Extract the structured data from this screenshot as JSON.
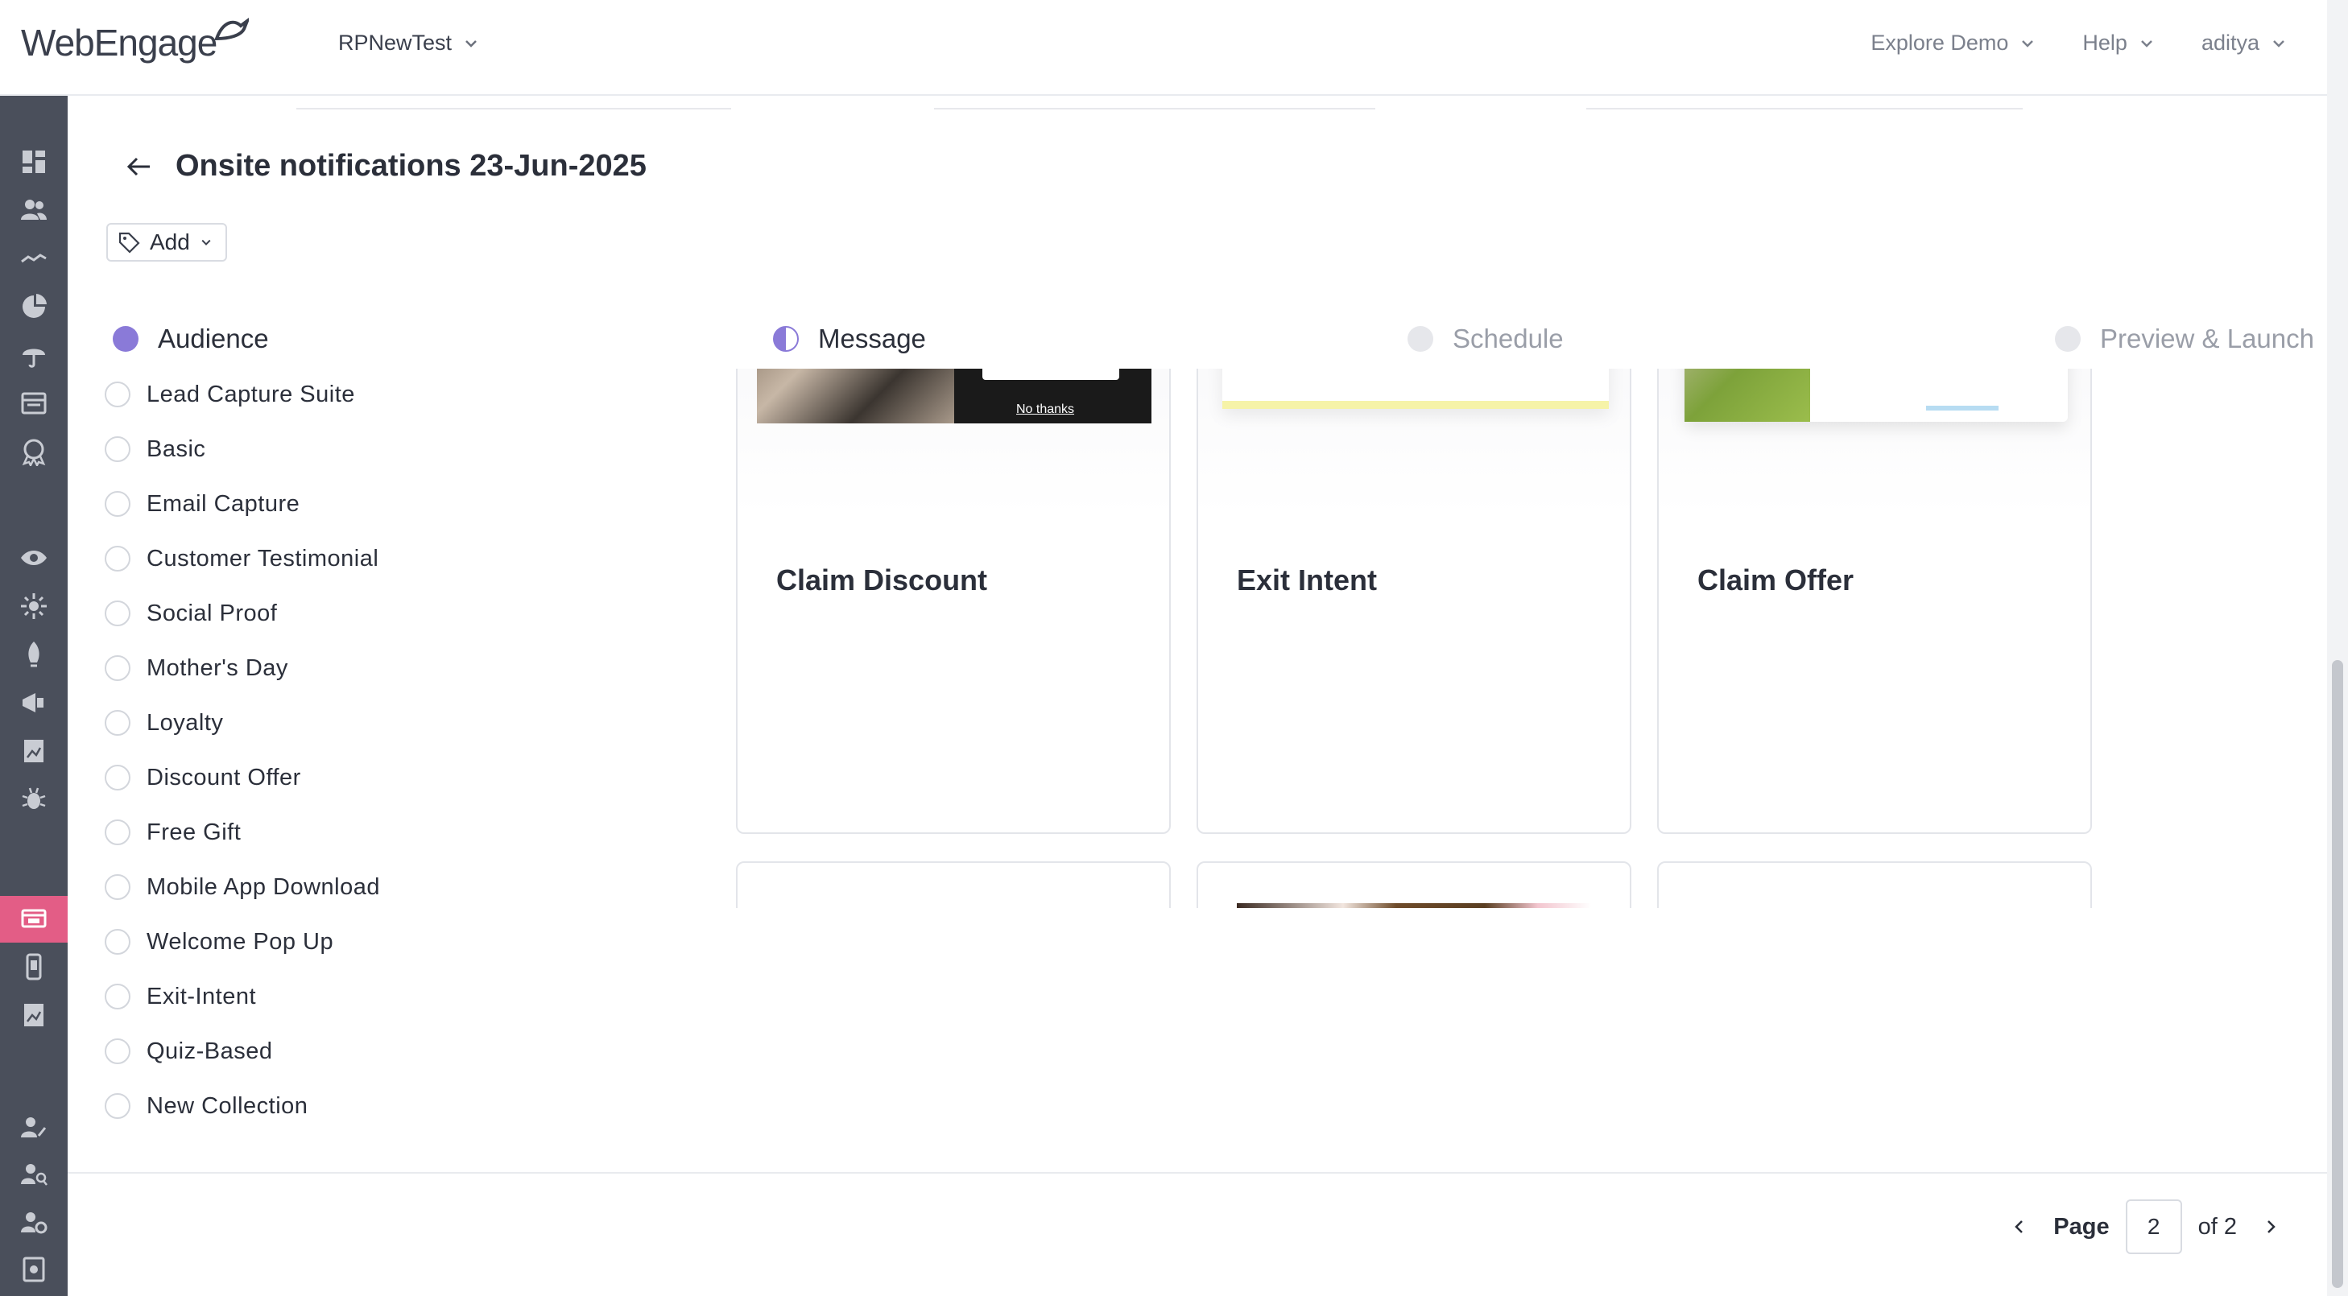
{
  "brand": {
    "logo_text": "WebEngage"
  },
  "topbar": {
    "project_name": "RPNewTest",
    "nav": [
      {
        "label": "Explore Demo"
      },
      {
        "label": "Help"
      },
      {
        "label": "aditya"
      }
    ]
  },
  "sidebar": {
    "icons": [
      "dashboard-icon",
      "users-icon",
      "trend-icon",
      "pie-chart-icon",
      "umbrella-icon",
      "archive-icon",
      "badge-icon",
      "eye-icon",
      "sparkle-icon",
      "rocket-icon",
      "megaphone-icon",
      "report-icon",
      "bug-icon",
      "onsite-icon",
      "mobile-icon",
      "analytics-icon",
      "user-edit-icon",
      "user-search-icon",
      "user-settings-icon",
      "billing-icon"
    ],
    "active": "onsite-icon"
  },
  "page": {
    "title": "Onsite notifications 23-Jun-2025",
    "tag_button_label": "Add"
  },
  "steps": [
    {
      "label": "Audience",
      "state": "done"
    },
    {
      "label": "Message",
      "state": "current"
    },
    {
      "label": "Schedule",
      "state": "pending"
    },
    {
      "label": "Preview & Launch",
      "state": "pending"
    }
  ],
  "filters": [
    "Lead Capture Suite",
    "Basic",
    "Email Capture",
    "Customer Testimonial",
    "Social Proof",
    "Mother's Day",
    "Loyalty",
    "Discount Offer",
    "Free Gift",
    "Mobile App Download",
    "Welcome Pop Up",
    "Exit-Intent",
    "Quiz-Based",
    "New Collection"
  ],
  "templates": [
    {
      "name": "Claim Discount",
      "preview_text": "No thanks"
    },
    {
      "name": "Exit Intent"
    },
    {
      "name": "Claim Offer"
    },
    {
      "name": ""
    },
    {
      "name": ""
    },
    {
      "name": ""
    }
  ],
  "pagination": {
    "label": "Page",
    "current": "2",
    "of_label": "of 2"
  },
  "colors": {
    "accent": "#8a7ad8",
    "sidebar": "#4a4f5b",
    "active_item": "#e35d86"
  }
}
